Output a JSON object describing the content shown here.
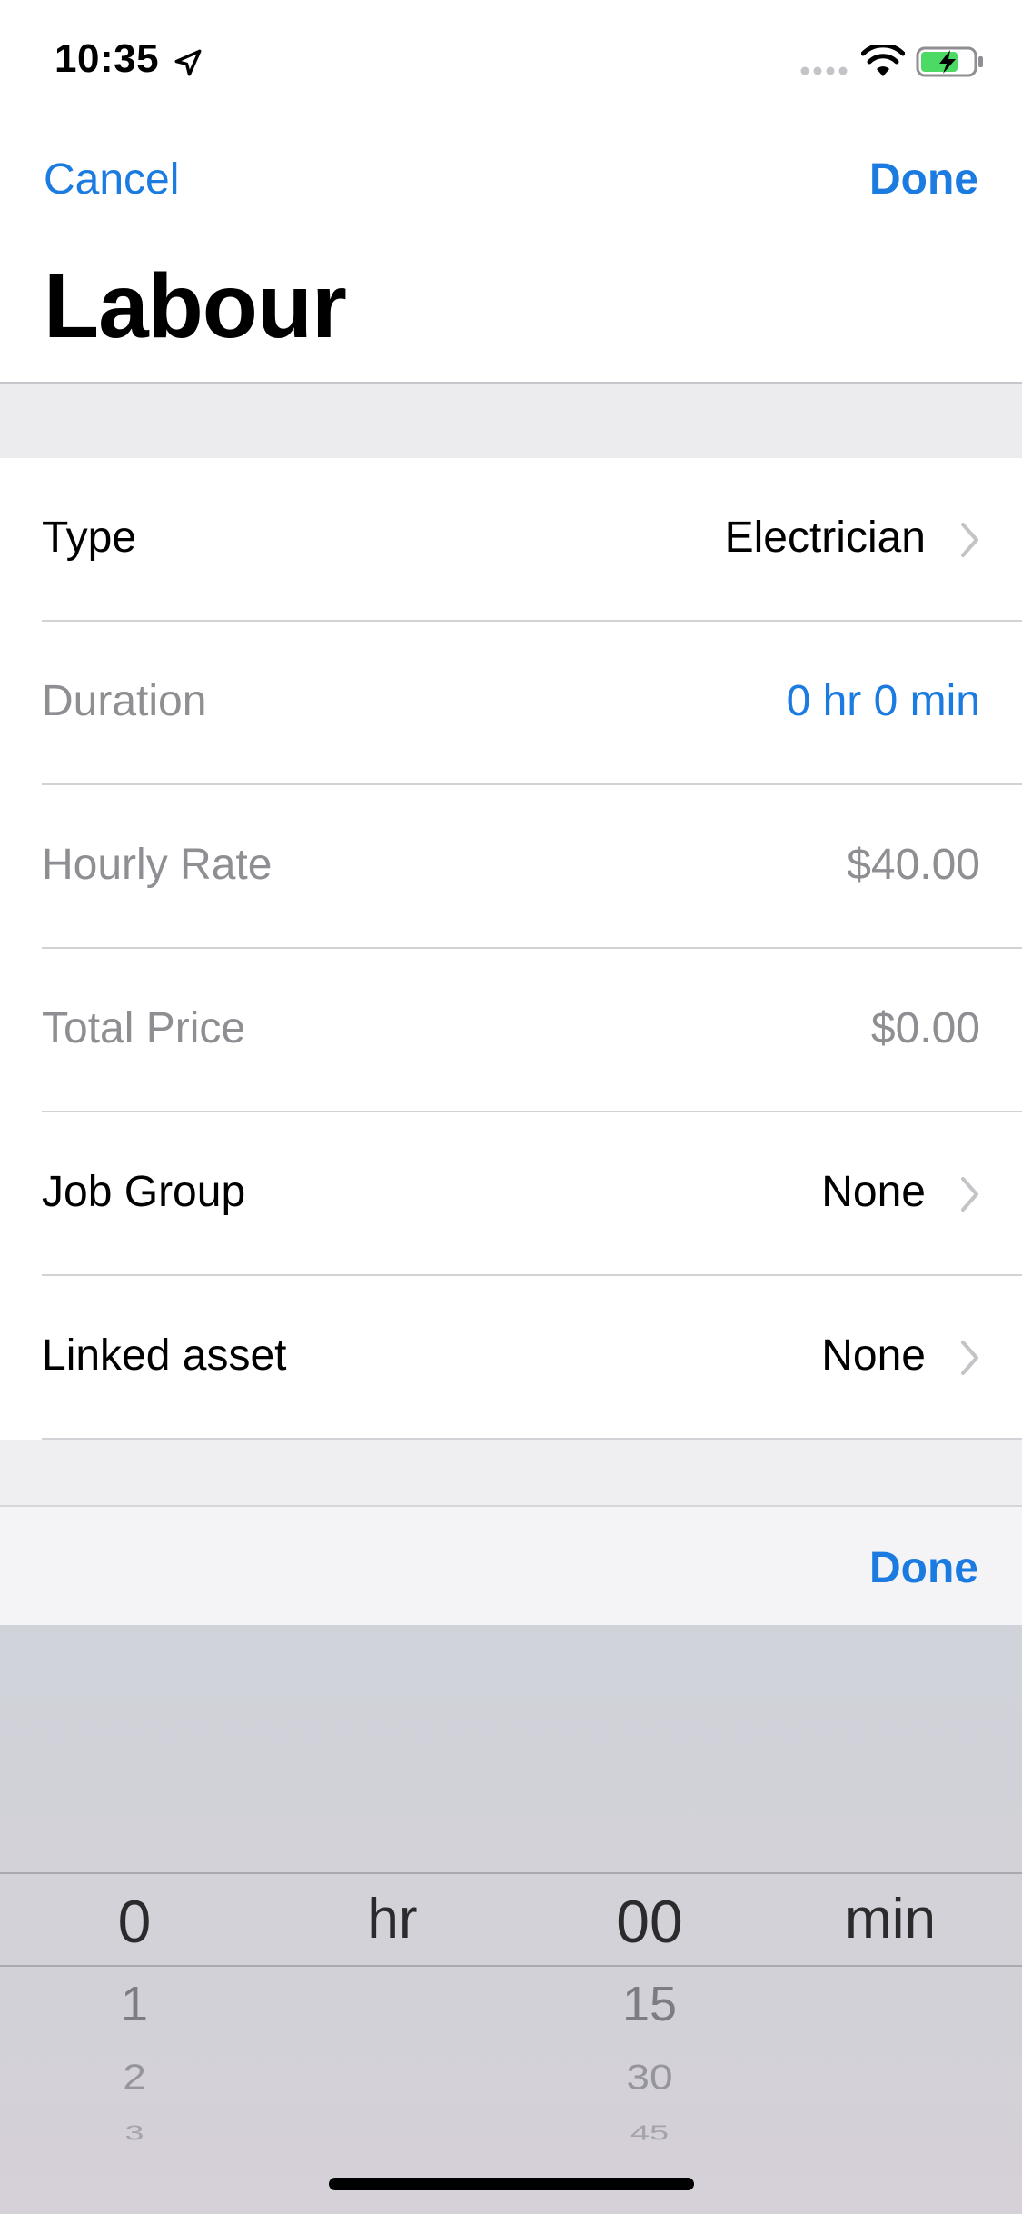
{
  "status_bar": {
    "time": "10:35",
    "battery_color": "#4cd964"
  },
  "nav": {
    "cancel_label": "Cancel",
    "done_label": "Done",
    "title": "Labour"
  },
  "form": {
    "rows": [
      {
        "label": "Type",
        "value": "Electrician"
      },
      {
        "label": "Duration",
        "value": "0 hr 0 min"
      },
      {
        "label": "Hourly Rate",
        "value": "$40.00"
      },
      {
        "label": "Total Price",
        "value": "$0.00"
      },
      {
        "label": "Job Group",
        "value": "None"
      },
      {
        "label": "Linked asset",
        "value": "None"
      }
    ]
  },
  "toolbar": {
    "done_label": "Done"
  },
  "picker": {
    "hours": {
      "selected": "0",
      "options": [
        "1",
        "2",
        "3"
      ],
      "unit": "hr"
    },
    "minutes": {
      "selected": "00",
      "options": [
        "15",
        "30",
        "45"
      ],
      "unit": "min"
    }
  },
  "colors": {
    "accent": "#1b7be0",
    "muted_text": "#8e8e93"
  }
}
